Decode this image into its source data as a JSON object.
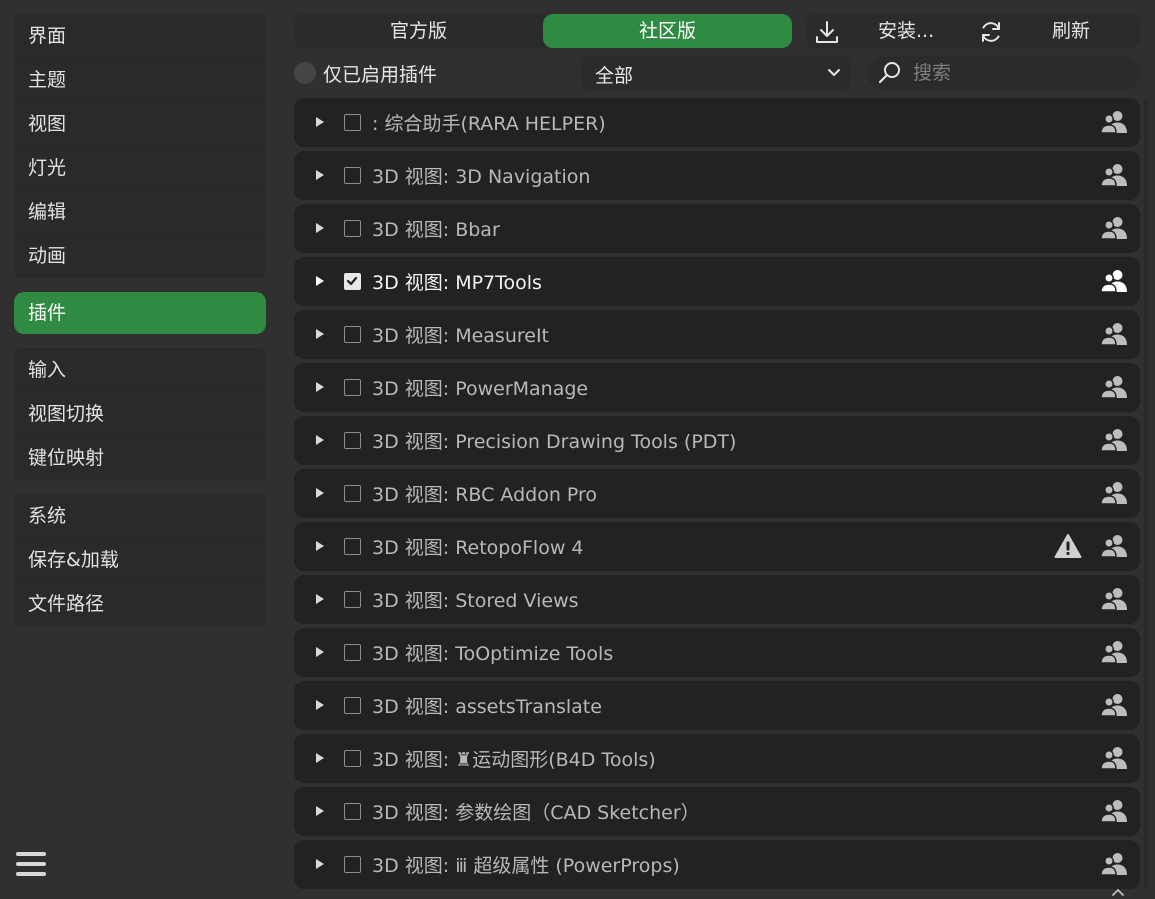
{
  "sidebar": {
    "groups": [
      [
        "界面",
        "主题",
        "视图",
        "灯光",
        "编辑",
        "动画"
      ],
      [
        "插件"
      ],
      [
        "输入",
        "视图切换",
        "键位映射"
      ],
      [
        "系统",
        "保存&加载",
        "文件路径"
      ]
    ],
    "items": {
      "interface": "界面",
      "themes": "主题",
      "viewport": "视图",
      "lights": "灯光",
      "editing": "编辑",
      "animation": "动画",
      "addons": "插件",
      "input": "输入",
      "navigation": "视图切换",
      "keymap": "键位映射",
      "system": "系统",
      "save_load": "保存&加载",
      "file_paths": "文件路径"
    },
    "active": "插件"
  },
  "topbar": {
    "official_label": "官方版",
    "community_label": "社区版",
    "install_label": "安装...",
    "refresh_label": "刷新",
    "active_tab": "社区版"
  },
  "filters": {
    "enabled_only_label": "仅已启用插件",
    "category_value": "全部",
    "search_placeholder": "搜索"
  },
  "addons": [
    {
      "name": ": 综合助手(RARA HELPER)",
      "enabled": false,
      "warning": false
    },
    {
      "name": "3D 视图: 3D Navigation",
      "enabled": false,
      "warning": false
    },
    {
      "name": "3D 视图: Bbar",
      "enabled": false,
      "warning": false
    },
    {
      "name": "3D 视图: MP7Tools",
      "enabled": true,
      "warning": false
    },
    {
      "name": "3D 视图: MeasureIt",
      "enabled": false,
      "warning": false
    },
    {
      "name": "3D 视图: PowerManage",
      "enabled": false,
      "warning": false
    },
    {
      "name": "3D 视图: Precision Drawing Tools (PDT)",
      "enabled": false,
      "warning": false
    },
    {
      "name": "3D 视图: RBC Addon Pro",
      "enabled": false,
      "warning": false
    },
    {
      "name": "3D 视图: RetopoFlow 4",
      "enabled": false,
      "warning": true
    },
    {
      "name": "3D 视图: Stored Views",
      "enabled": false,
      "warning": false
    },
    {
      "name": "3D 视图: ToOptimize Tools",
      "enabled": false,
      "warning": false
    },
    {
      "name": "3D 视图: assetsTranslate",
      "enabled": false,
      "warning": false
    },
    {
      "name": "3D 视图: ♜运动图形(B4D Tools)",
      "enabled": false,
      "warning": false
    },
    {
      "name": "3D 视图: 参数绘图（CAD Sketcher）",
      "enabled": false,
      "warning": false
    },
    {
      "name": "3D 视图: ⅲ 超级属性 (PowerProps)",
      "enabled": false,
      "warning": false
    }
  ],
  "icons": {
    "menu": "hamburger-menu-icon",
    "install": "download-icon",
    "refresh": "refresh-icon",
    "search": "search-icon",
    "dropdown": "chevron-down-icon",
    "expand": "disclosure-triangle-icon",
    "user": "community-user-icon",
    "warning": "warning-icon"
  },
  "colors": {
    "accent": "#2f8a42",
    "background": "#303030",
    "row": "#222222",
    "panel": "#2b2b2b"
  }
}
